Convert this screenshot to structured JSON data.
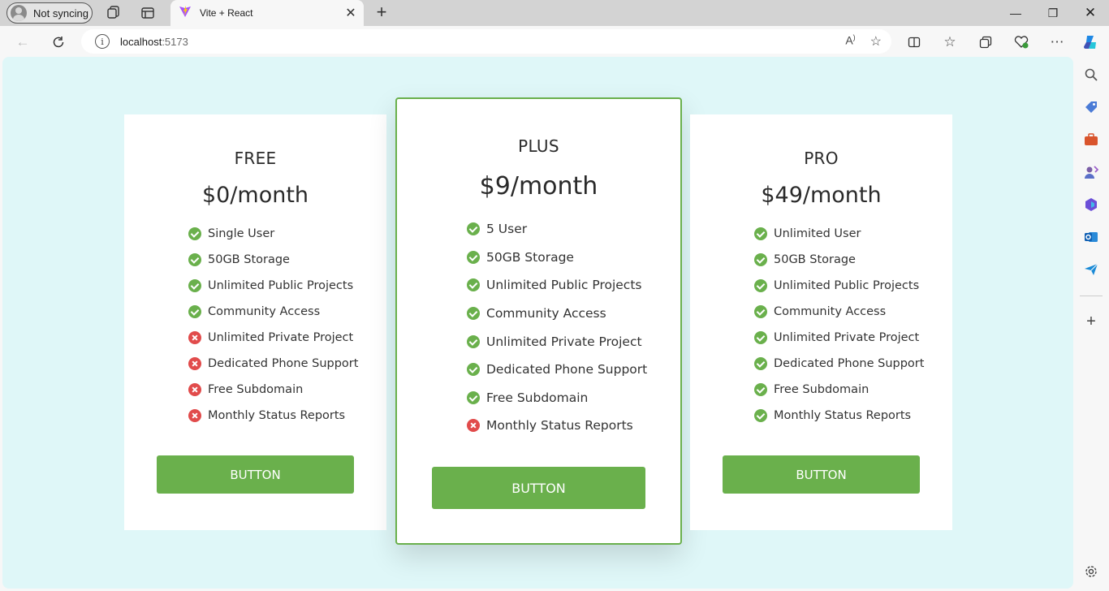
{
  "browser": {
    "profile_label": "Not syncing",
    "tab_title": "Vite + React",
    "url_host": "localhost",
    "url_port": ":5173",
    "colors": {
      "titlebar": "#d3d3d3",
      "toolbar": "#f7f7f7"
    }
  },
  "page": {
    "background": "#dff7f8",
    "accent": "#6ab04c",
    "negative": "#e14b4b",
    "plans": [
      {
        "name": "FREE",
        "price": "$0/month",
        "button": "BUTTON",
        "features": [
          {
            "label": "Single User",
            "included": true
          },
          {
            "label": "50GB Storage",
            "included": true
          },
          {
            "label": "Unlimited Public Projects",
            "included": true
          },
          {
            "label": "Community Access",
            "included": true
          },
          {
            "label": "Unlimited Private Project",
            "included": false
          },
          {
            "label": "Dedicated Phone Support",
            "included": false
          },
          {
            "label": "Free Subdomain",
            "included": false
          },
          {
            "label": "Monthly Status Reports",
            "included": false
          }
        ]
      },
      {
        "name": "PLUS",
        "price": "$9/month",
        "button": "BUTTON",
        "featured": true,
        "features": [
          {
            "label": "5 User",
            "included": true
          },
          {
            "label": "50GB Storage",
            "included": true
          },
          {
            "label": "Unlimited Public Projects",
            "included": true
          },
          {
            "label": "Community Access",
            "included": true
          },
          {
            "label": "Unlimited Private Project",
            "included": true
          },
          {
            "label": "Dedicated Phone Support",
            "included": true
          },
          {
            "label": "Free Subdomain",
            "included": true
          },
          {
            "label": "Monthly Status Reports",
            "included": false
          }
        ]
      },
      {
        "name": "PRO",
        "price": "$49/month",
        "button": "BUTTON",
        "features": [
          {
            "label": "Unlimited User",
            "included": true
          },
          {
            "label": "50GB Storage",
            "included": true
          },
          {
            "label": "Unlimited Public Projects",
            "included": true
          },
          {
            "label": "Community Access",
            "included": true
          },
          {
            "label": "Unlimited Private Project",
            "included": true
          },
          {
            "label": "Dedicated Phone Support",
            "included": true
          },
          {
            "label": "Free Subdomain",
            "included": true
          },
          {
            "label": "Monthly Status Reports",
            "included": true
          }
        ]
      }
    ]
  }
}
